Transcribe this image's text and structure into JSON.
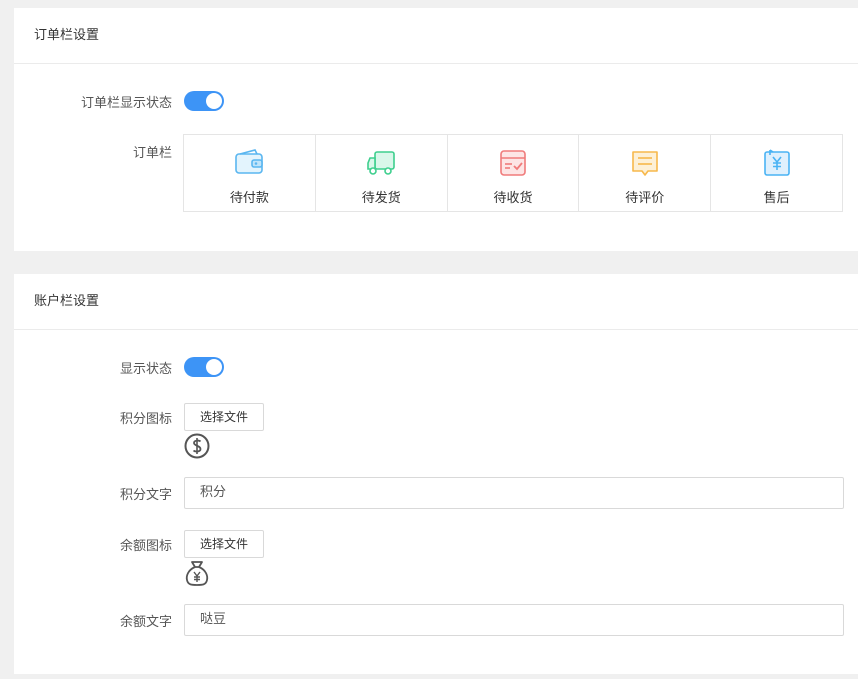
{
  "order_section": {
    "title": "订单栏设置",
    "display_status_label": "订单栏显示状态",
    "display_status_on": true,
    "order_bar_label": "订单栏",
    "items": [
      {
        "label": "待付款",
        "icon": "wallet-icon",
        "color": "#5ab6f0"
      },
      {
        "label": "待发货",
        "icon": "truck-icon",
        "color": "#3ecf8e"
      },
      {
        "label": "待收货",
        "icon": "box-check-icon",
        "color": "#f07b7b"
      },
      {
        "label": "待评价",
        "icon": "comment-icon",
        "color": "#f7b84b"
      },
      {
        "label": "售后",
        "icon": "refund-icon",
        "color": "#4ab3f4"
      }
    ]
  },
  "account_section": {
    "title": "账户栏设置",
    "display_status_label": "显示状态",
    "display_status_on": true,
    "points_icon_label": "积分图标",
    "points_icon_button": "选择文件",
    "points_text_label": "积分文字",
    "points_text_value": "积分",
    "balance_icon_label": "余额图标",
    "balance_icon_button": "选择文件",
    "balance_text_label": "余额文字",
    "balance_text_value": "哒豆"
  },
  "colors": {
    "accent": "#3d94f6"
  }
}
